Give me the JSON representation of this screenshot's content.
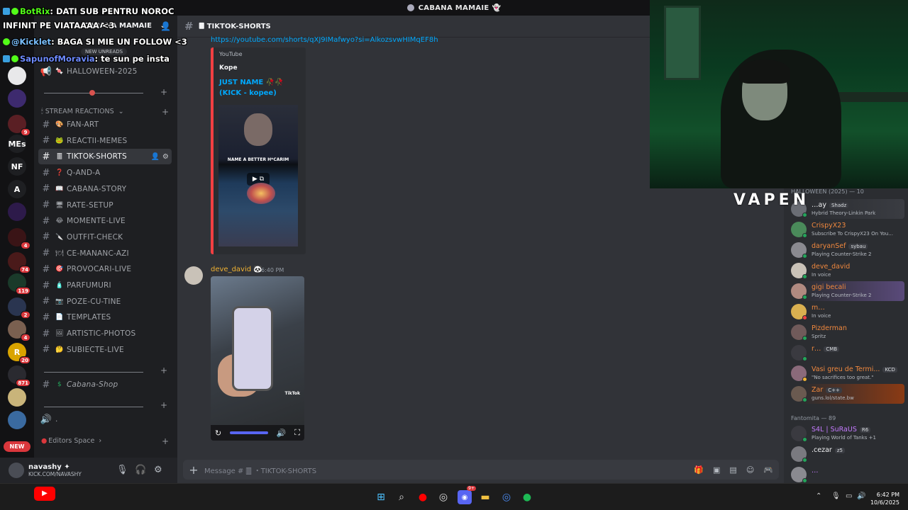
{
  "window": {
    "title": "CABANA MAMAIE"
  },
  "overlay": {
    "lines": [
      {
        "user": "BotRix",
        "text": ": DATI SUB PENTRU NOROC"
      },
      {
        "user": "",
        "text": "INFINIT PE VIATAAAA <3"
      },
      {
        "user": "@Kicklet",
        "text": ": BAGA SI MIE UN FOLLOW <3"
      },
      {
        "user": "SapunofMoravia",
        "text": ": te sun pe insta"
      }
    ],
    "new_unreads": "NEW UNREADS"
  },
  "rail": {
    "servers": [
      {
        "label": "",
        "color": "#e8e8ea",
        "badge": ""
      },
      {
        "label": "",
        "color": "#3d2a6e",
        "badge": ""
      },
      {
        "label": "",
        "color": "#5a1f24",
        "badge": "9"
      },
      {
        "label": "MEs",
        "color": "#1e1f22",
        "badge": ""
      },
      {
        "label": "NF",
        "color": "#1e1f22",
        "badge": ""
      },
      {
        "label": "A",
        "color": "#1e1f22",
        "badge": ""
      },
      {
        "label": "",
        "color": "#2d1a4a",
        "badge": ""
      },
      {
        "label": "",
        "color": "#3a1416",
        "badge": "4"
      },
      {
        "label": "",
        "color": "#4a1a1a",
        "badge": "74"
      },
      {
        "label": "",
        "color": "#1a3a2a",
        "badge": "119"
      },
      {
        "label": "",
        "color": "#2a3550",
        "badge": "2"
      },
      {
        "label": "",
        "color": "#7a6050",
        "badge": "4"
      },
      {
        "label": "R",
        "color": "#d9a400",
        "badge": "20"
      },
      {
        "label": "",
        "color": "#2a2a30",
        "badge": "871"
      },
      {
        "label": "",
        "color": "#c9b47a",
        "badge": ""
      },
      {
        "label": "",
        "color": "#3a6aa0",
        "badge": ""
      }
    ],
    "new_pill": "NEW"
  },
  "sidebar": {
    "server_name": "CABANA MAMAIE",
    "halloween_channel": "HALLOWEEN-2025",
    "category_stream": "STREAM REACTIONS",
    "channels": [
      {
        "emoji": "🎨",
        "name": "FAN-ART",
        "active": false
      },
      {
        "emoji": "🐸",
        "name": "REACTII-MEMES",
        "active": false
      },
      {
        "emoji": "🀫",
        "name": "TIKTOK-SHORTS",
        "active": true
      },
      {
        "emoji": "❓",
        "name": "Q-AND-A",
        "active": false
      },
      {
        "emoji": "📖",
        "name": "CABANA-STORY",
        "active": false
      },
      {
        "emoji": "🖥",
        "name": "RATE-SETUP",
        "active": false
      },
      {
        "emoji": "😂",
        "name": "MOMENTE-LIVE",
        "active": false
      },
      {
        "emoji": "🔪",
        "name": "OUTFIT-CHECK",
        "active": false
      },
      {
        "emoji": "🍽",
        "name": "CE-MANANC-AZI",
        "active": false
      },
      {
        "emoji": "🎯",
        "name": "PROVOCARI-LIVE",
        "active": false
      },
      {
        "emoji": "🧴",
        "name": "PARFUMURI",
        "active": false
      },
      {
        "emoji": "📷",
        "name": "POZE-CU-TINE",
        "active": false
      },
      {
        "emoji": "📄",
        "name": "TEMPLATES",
        "active": false
      },
      {
        "emoji": "🖼",
        "name": "ARTISTIC-PHOTOS",
        "active": false
      },
      {
        "emoji": "🤔",
        "name": "SUBIECTE-LIVE",
        "active": false
      }
    ],
    "shop_channel": "Cabana-Shop",
    "voice_channel": ".",
    "editors_category": "Editors Space"
  },
  "user_panel": {
    "name": "navashy ✦",
    "status": "KICK.COM/NAVASHY"
  },
  "chat": {
    "channel_name": "TIKTOK-SHORTS",
    "link": "https://youtube.com/shorts/qXJ9IMafwyo?si=AlkozsvwHIMqEF8h",
    "embed": {
      "provider": "YouTube",
      "author": "Kope",
      "title": "JUST NAME 🥀🥀 (KICK - kopee)",
      "thumb_caption": "NAME A BETTER H*CARIM"
    },
    "message": {
      "author": "deve_david",
      "time": "6:40 PM",
      "tiktok_label": "TikTok"
    },
    "composer_placeholder": "Message # 🀫 ・TIKTOK-SHORTS"
  },
  "overlay_brand": "VAPEN",
  "members": {
    "group_halloween": "HALLOWEEN (2025) — 10",
    "group_fantomita": "Fantomita — 89",
    "list": [
      {
        "name": "…ay",
        "tag": "Shadz",
        "status": "Hybrid Theory-Linkin Park",
        "color": "#f2f3f5",
        "dot": "#23a55a",
        "av": "#6a6d74",
        "highlight": "#3a3c42"
      },
      {
        "name": "CrispyX23",
        "tag": "",
        "status": "Subscribe To CrispyX23 On You...",
        "color": "#f0883e",
        "dot": "#23a55a",
        "av": "#4a8a5a",
        "highlight": ""
      },
      {
        "name": "daryanSef",
        "tag": "sybau",
        "status": "Playing Counter-Strike 2",
        "color": "#f0883e",
        "dot": "#23a55a",
        "av": "#8a8a90",
        "highlight": ""
      },
      {
        "name": "deve_david",
        "tag": "",
        "status": "In voice",
        "color": "#f0883e",
        "dot": "#23a55a",
        "av": "#c9c2b8",
        "highlight": ""
      },
      {
        "name": "gigi becali",
        "tag": "",
        "status": "Playing Counter-Strike 2",
        "color": "#f0883e",
        "dot": "#23a55a",
        "av": "#b08a80",
        "highlight": "#5a4a7a"
      },
      {
        "name": "m…",
        "tag": "",
        "status": "In voice",
        "color": "#f0883e",
        "dot": "#f23f42",
        "av": "#d9b050",
        "highlight": ""
      },
      {
        "name": "Pizderman",
        "tag": "",
        "status": "Spritz",
        "color": "#f0883e",
        "dot": "#23a55a",
        "av": "#705a5a",
        "highlight": ""
      },
      {
        "name": "r…",
        "tag": "CMB",
        "status": "",
        "color": "#f0883e",
        "dot": "#23a55a",
        "av": "#3a3a40",
        "highlight": ""
      },
      {
        "name": "Vasi greu de Termi...",
        "tag": "KCD",
        "status": "\"No sacrifices too great.\"",
        "color": "#f0883e",
        "dot": "#f0b232",
        "av": "#8a6a7a",
        "highlight": ""
      },
      {
        "name": "Zar",
        "tag": "C++",
        "status": "guns.lol/state.bw",
        "color": "#f0883e",
        "dot": "#23a55a",
        "av": "#6a5a50",
        "highlight": "#8a3a14"
      },
      {
        "name": "S4L | SuRaUS",
        "tag": "R6",
        "status": "Playing World of Tanks +1",
        "color": "#c57bff",
        "dot": "#23a55a",
        "av": "#3a3a40",
        "highlight": ""
      },
      {
        "name": ".cezar",
        "tag": "z5",
        "status": "",
        "color": "#f2f3f5",
        "dot": "#23a55a",
        "av": "#7a7a80",
        "highlight": ""
      },
      {
        "name": "…",
        "tag": "",
        "status": "",
        "color": "#c57bff",
        "dot": "#23a55a",
        "av": "#8a8a90",
        "highlight": ""
      }
    ]
  },
  "taskbar": {
    "time": "6:42 PM",
    "date": "10/6/2025",
    "apps": [
      "windows-start",
      "search",
      "youtube-music",
      "chrome",
      "discord",
      "file-explorer",
      "chrome-alt",
      "spotify"
    ],
    "discord_badge": "9+"
  },
  "colors": {
    "accent": "#5865f2",
    "kick_green": "#53fc18",
    "red": "#da373c"
  }
}
